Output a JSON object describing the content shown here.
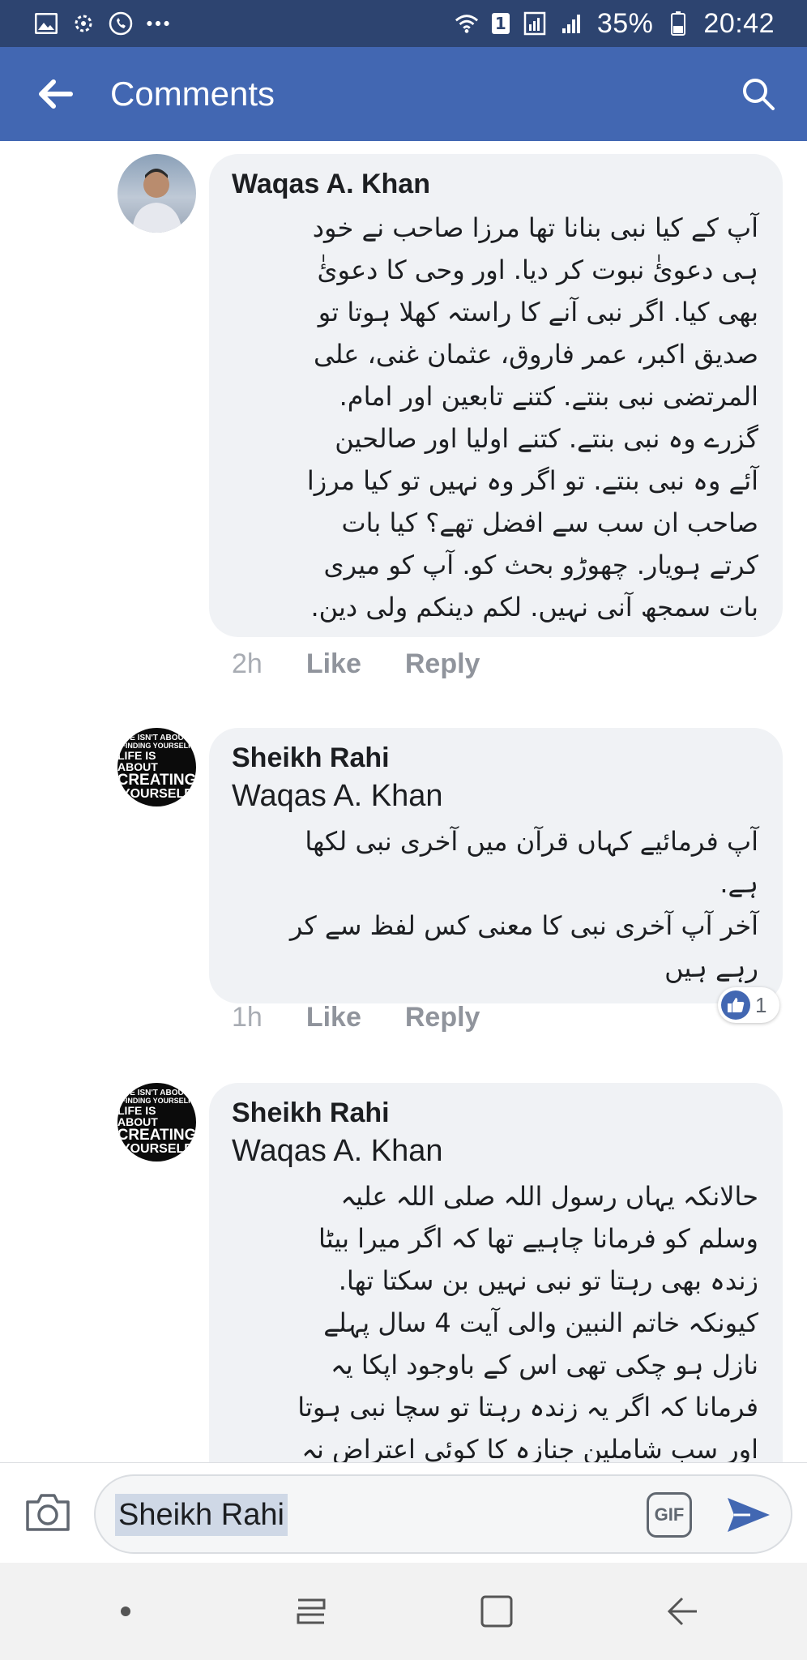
{
  "status_bar": {
    "battery": "35%",
    "time": "20:42",
    "sim_badge": "1",
    "left_icons": [
      "image-icon",
      "sync-icon",
      "phone-icon",
      "more-dots-icon"
    ],
    "right_icons": [
      "wifi-icon",
      "sim-badge",
      "signal-icon",
      "battery-icon"
    ]
  },
  "app_bar": {
    "title": "Comments",
    "color": "#4267b2"
  },
  "comments": [
    {
      "author": "Waqas A. Khan",
      "mention": "",
      "text": "آپ کے کیا نبی بنانا تھا مرزا صاحب نے خود\nہی دعوئٰ نبوت کر دیا. اور وحی کا دعوئٰ\nبھی کیا. اگر نبی آنے کا راستہ کھلا ہوتا تو\nصدیق اکبر، عمر فاروق، عثمان غنی، علی\nالمرتضی نبی بنتے. کتنے تابعین اور امام.\nگزرے وہ نبی بنتے. کتنے اولیا اور صالحین\nآئے وہ نبی بنتے. تو اگر وہ نہیں تو کیا مرزا\nصاحب ان سب سے افضل تھے؟ کیا بات\nکرتے ہویار. چھوڑو بحث کو. آپ کو میری\nبات سمجھ آنی نہیں. لکم دینکم ولی دین.",
      "time": "2h",
      "like": "Like",
      "reply": "Reply"
    },
    {
      "author": "Sheikh Rahi",
      "mention": "Waqas A. Khan",
      "text": "آپ فرمائیے کہاں قرآن میں آخری نبی لکھا\nہے.\nآخر آپ آخری نبی کا معنی کس لفظ سے کر\nرہے ہیں",
      "time": "1h",
      "like": "Like",
      "reply": "Reply",
      "reaction_count": "1"
    },
    {
      "author": "Sheikh Rahi",
      "mention": "Waqas A. Khan",
      "text": "حالانکہ یہاں رسول اللہ صلی اللہ علیہ\nوسلم کو فرمانا چاہیے تھا کہ اگر میرا بیٹا\nزندہ بھی رہتا تو نبی نہیں بن سکتا تھا.\nکیونکہ خاتم النبین والی آیت 4 سال پہلے\nنازل ہو چکی تھی اس کے باوجود اپکا یہ\nفرمانا کہ اگر یہ زندہ رہتا تو سچا نبی ہوتا\nاور سب شاملین جنازہ کا کوئی اعتراض نہ"
    }
  ],
  "avatar_text": {
    "line1": "E ISN'T ABOU",
    "line2": "FINDING YOURSELF",
    "line3": "LIFE IS ABOUT",
    "line4": "CREATING",
    "line5": "YOURSELF"
  },
  "composer": {
    "value": "Sheikh Rahi",
    "gif_label": "GIF"
  }
}
